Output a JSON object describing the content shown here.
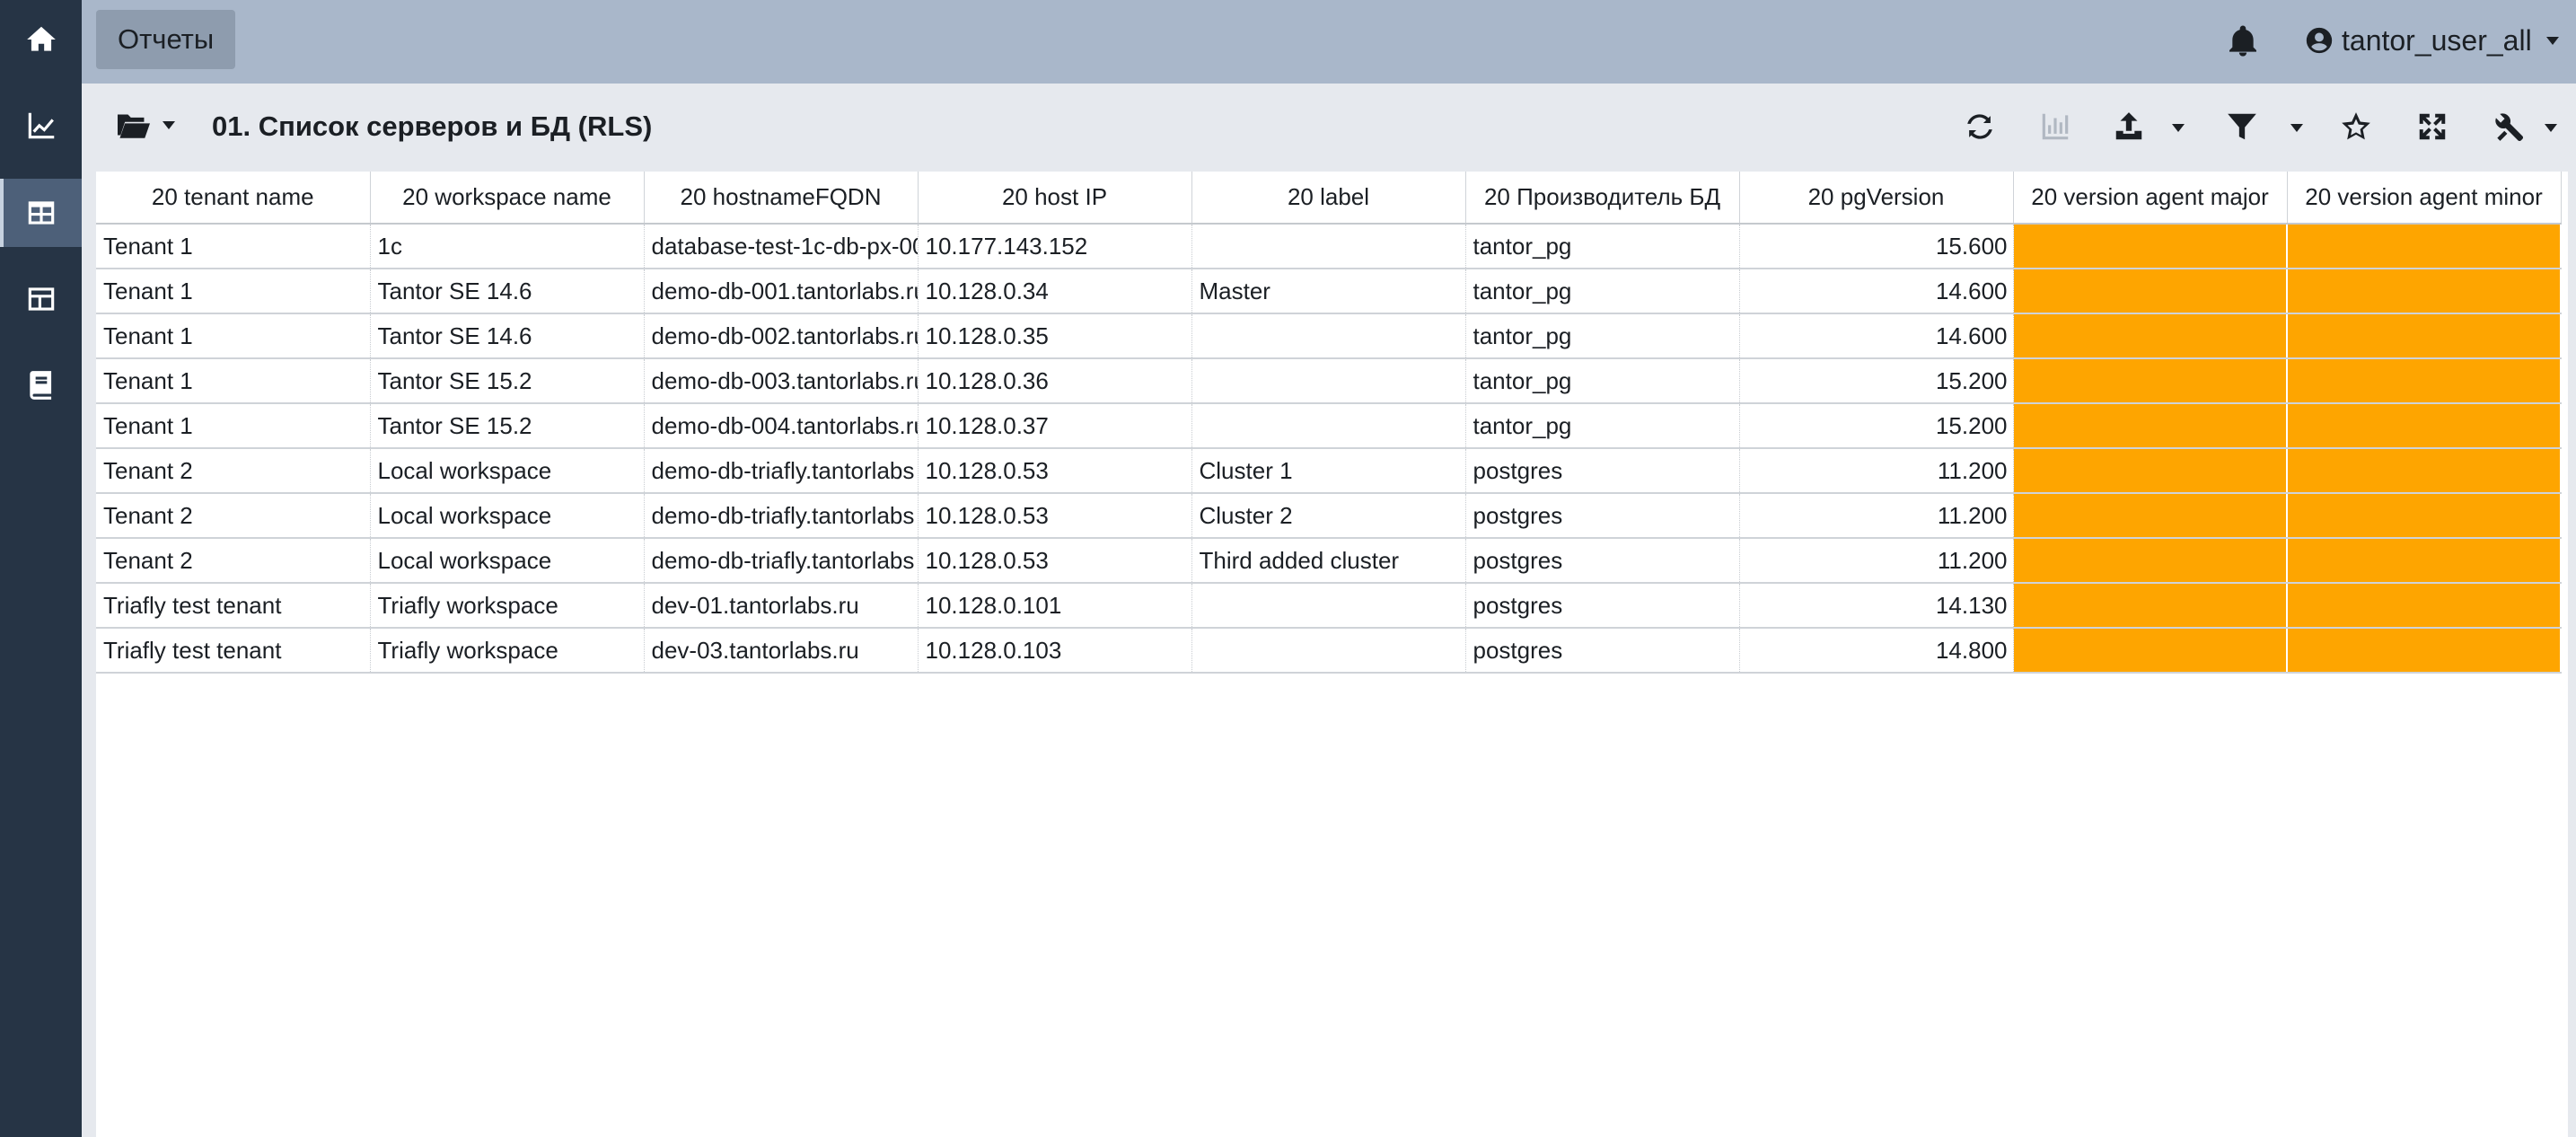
{
  "sidebar": {
    "items": [
      {
        "icon": "home-icon"
      },
      {
        "icon": "chart-line-icon"
      },
      {
        "icon": "table-icon",
        "active": true
      },
      {
        "icon": "layout-icon"
      },
      {
        "icon": "book-icon"
      }
    ]
  },
  "topbar": {
    "reports_label": "Отчеты",
    "user_name": "tantor_user_all"
  },
  "toolbar": {
    "title": "01. Список серверов и БД (RLS)"
  },
  "colors": {
    "sidebar": "#263445",
    "topbar": "#a9b7ca",
    "highlight_cell": "#fea500"
  },
  "table": {
    "columns": [
      "20 tenant name",
      "20 workspace name",
      "20 hostnameFQDN",
      "20 host IP",
      "20 label",
      "20 Производитель БД",
      "20 pgVersion",
      "20 version agent major",
      "20 version agent minor"
    ],
    "rows": [
      [
        "Tenant 1",
        "1c",
        "database-test-1c-db-px-00",
        "10.177.143.152",
        "",
        "tantor_pg",
        "15.600",
        "",
        ""
      ],
      [
        "Tenant 1",
        "Tantor SE 14.6",
        "demo-db-001.tantorlabs.ru",
        "10.128.0.34",
        "Master",
        "tantor_pg",
        "14.600",
        "",
        ""
      ],
      [
        "Tenant 1",
        "Tantor SE 14.6",
        "demo-db-002.tantorlabs.ru",
        "10.128.0.35",
        "",
        "tantor_pg",
        "14.600",
        "",
        ""
      ],
      [
        "Tenant 1",
        "Tantor SE 15.2",
        "demo-db-003.tantorlabs.ru",
        "10.128.0.36",
        "",
        "tantor_pg",
        "15.200",
        "",
        ""
      ],
      [
        "Tenant 1",
        "Tantor SE 15.2",
        "demo-db-004.tantorlabs.ru",
        "10.128.0.37",
        "",
        "tantor_pg",
        "15.200",
        "",
        ""
      ],
      [
        "Tenant 2",
        "Local workspace",
        "demo-db-triafly.tantorlabs",
        "10.128.0.53",
        "Cluster 1",
        "postgres",
        "11.200",
        "",
        ""
      ],
      [
        "Tenant 2",
        "Local workspace",
        "demo-db-triafly.tantorlabs",
        "10.128.0.53",
        "Cluster 2",
        "postgres",
        "11.200",
        "",
        ""
      ],
      [
        "Tenant 2",
        "Local workspace",
        "demo-db-triafly.tantorlabs",
        "10.128.0.53",
        "Third added cluster",
        "postgres",
        "11.200",
        "",
        ""
      ],
      [
        "Triafly test tenant",
        "Triafly workspace",
        "dev-01.tantorlabs.ru",
        "10.128.0.101",
        "",
        "postgres",
        "14.130",
        "",
        ""
      ],
      [
        "Triafly test tenant",
        "Triafly workspace",
        "dev-03.tantorlabs.ru",
        "10.128.0.103",
        "",
        "postgres",
        "14.800",
        "",
        ""
      ]
    ]
  }
}
